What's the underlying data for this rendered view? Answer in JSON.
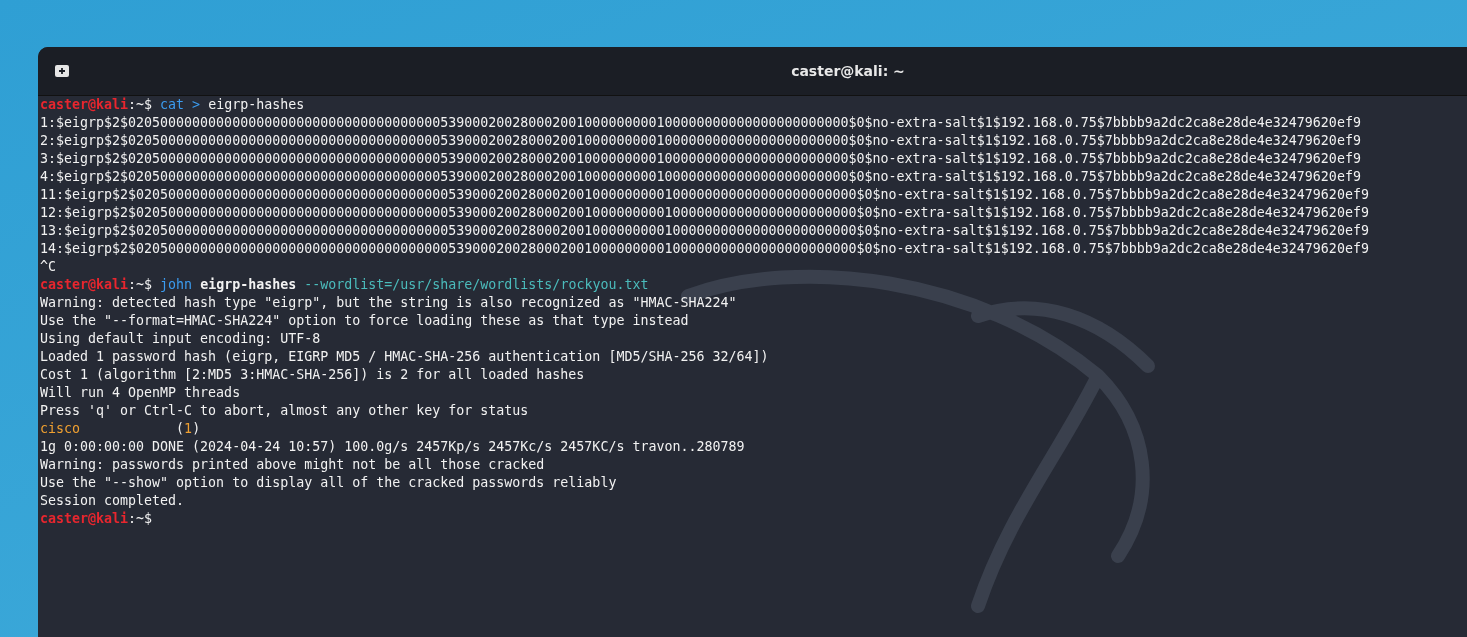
{
  "window": {
    "title": "caster@kali: ~"
  },
  "terminal": {
    "lines": [
      [
        {
          "text": "caster@kali",
          "kind": "user"
        },
        {
          "text": ":~$ ",
          "kind": "plain"
        },
        {
          "text": "cat > ",
          "kind": "command"
        },
        {
          "text": "eigrp-hashes",
          "kind": "plain"
        }
      ],
      [
        {
          "text": "1:$eigrp$2$020500000000000000000000000000000000000539000200280002001000000000100000000000000000000000$0$no-extra-salt$1$192.168.0.75$7bbbb9a2dc2ca8e28de4e32479620ef9",
          "kind": "plain"
        }
      ],
      [
        {
          "text": "2:$eigrp$2$020500000000000000000000000000000000000539000200280002001000000000100000000000000000000000$0$no-extra-salt$1$192.168.0.75$7bbbb9a2dc2ca8e28de4e32479620ef9",
          "kind": "plain"
        }
      ],
      [
        {
          "text": "3:$eigrp$2$020500000000000000000000000000000000000539000200280002001000000000100000000000000000000000$0$no-extra-salt$1$192.168.0.75$7bbbb9a2dc2ca8e28de4e32479620ef9",
          "kind": "plain"
        }
      ],
      [
        {
          "text": "4:$eigrp$2$020500000000000000000000000000000000000539000200280002001000000000100000000000000000000000$0$no-extra-salt$1$192.168.0.75$7bbbb9a2dc2ca8e28de4e32479620ef9",
          "kind": "plain"
        }
      ],
      [
        {
          "text": "11:$eigrp$2$020500000000000000000000000000000000000539000200280002001000000000100000000000000000000000$0$no-extra-salt$1$192.168.0.75$7bbbb9a2dc2ca8e28de4e32479620ef9",
          "kind": "plain"
        }
      ],
      [
        {
          "text": "12:$eigrp$2$020500000000000000000000000000000000000539000200280002001000000000100000000000000000000000$0$no-extra-salt$1$192.168.0.75$7bbbb9a2dc2ca8e28de4e32479620ef9",
          "kind": "plain"
        }
      ],
      [
        {
          "text": "13:$eigrp$2$020500000000000000000000000000000000000539000200280002001000000000100000000000000000000000$0$no-extra-salt$1$192.168.0.75$7bbbb9a2dc2ca8e28de4e32479620ef9",
          "kind": "plain"
        }
      ],
      [
        {
          "text": "14:$eigrp$2$020500000000000000000000000000000000000539000200280002001000000000100000000000000000000000$0$no-extra-salt$1$192.168.0.75$7bbbb9a2dc2ca8e28de4e32479620ef9",
          "kind": "plain"
        }
      ],
      [
        {
          "text": "^C",
          "kind": "plain"
        }
      ],
      [
        {
          "text": "caster@kali",
          "kind": "user"
        },
        {
          "text": ":~$ ",
          "kind": "plain"
        },
        {
          "text": "john ",
          "kind": "command"
        },
        {
          "text": "eigrp-hashes ",
          "kind": "bold"
        },
        {
          "text": "--wordlist=/usr/share/wordlists/rockyou.txt",
          "kind": "option"
        }
      ],
      [
        {
          "text": "Warning: detected hash type \"eigrp\", but the string is also recognized as \"HMAC-SHA224\"",
          "kind": "plain"
        }
      ],
      [
        {
          "text": "Use the \"--format=HMAC-SHA224\" option to force loading these as that type instead",
          "kind": "plain"
        }
      ],
      [
        {
          "text": "Using default input encoding: UTF-8",
          "kind": "plain"
        }
      ],
      [
        {
          "text": "Loaded 1 password hash (eigrp, EIGRP MD5 / HMAC-SHA-256 authentication [MD5/SHA-256 32/64])",
          "kind": "plain"
        }
      ],
      [
        {
          "text": "Cost 1 (algorithm [2:MD5 3:HMAC-SHA-256]) is 2 for all loaded hashes",
          "kind": "plain"
        }
      ],
      [
        {
          "text": "Will run 4 OpenMP threads",
          "kind": "plain"
        }
      ],
      [
        {
          "text": "Press 'q' or Ctrl-C to abort, almost any other key for status",
          "kind": "plain"
        }
      ],
      [
        {
          "text": "cisco",
          "kind": "cracked"
        },
        {
          "text": "            (",
          "kind": "plain"
        },
        {
          "text": "1",
          "kind": "cracked"
        },
        {
          "text": ")",
          "kind": "plain"
        }
      ],
      [
        {
          "text": "1g 0:00:00:00 DONE (2024-04-24 10:57) 100.0g/s 2457Kp/s 2457Kc/s 2457KC/s travon..280789",
          "kind": "plain"
        }
      ],
      [
        {
          "text": "Warning: passwords printed above might not be all those cracked",
          "kind": "plain"
        }
      ],
      [
        {
          "text": "Use the \"--show\" option to display all of the cracked passwords reliably",
          "kind": "plain"
        }
      ],
      [
        {
          "text": "Session completed.",
          "kind": "plain"
        }
      ],
      [
        {
          "text": "caster@kali",
          "kind": "user"
        },
        {
          "text": ":~$",
          "kind": "plain"
        }
      ]
    ]
  }
}
